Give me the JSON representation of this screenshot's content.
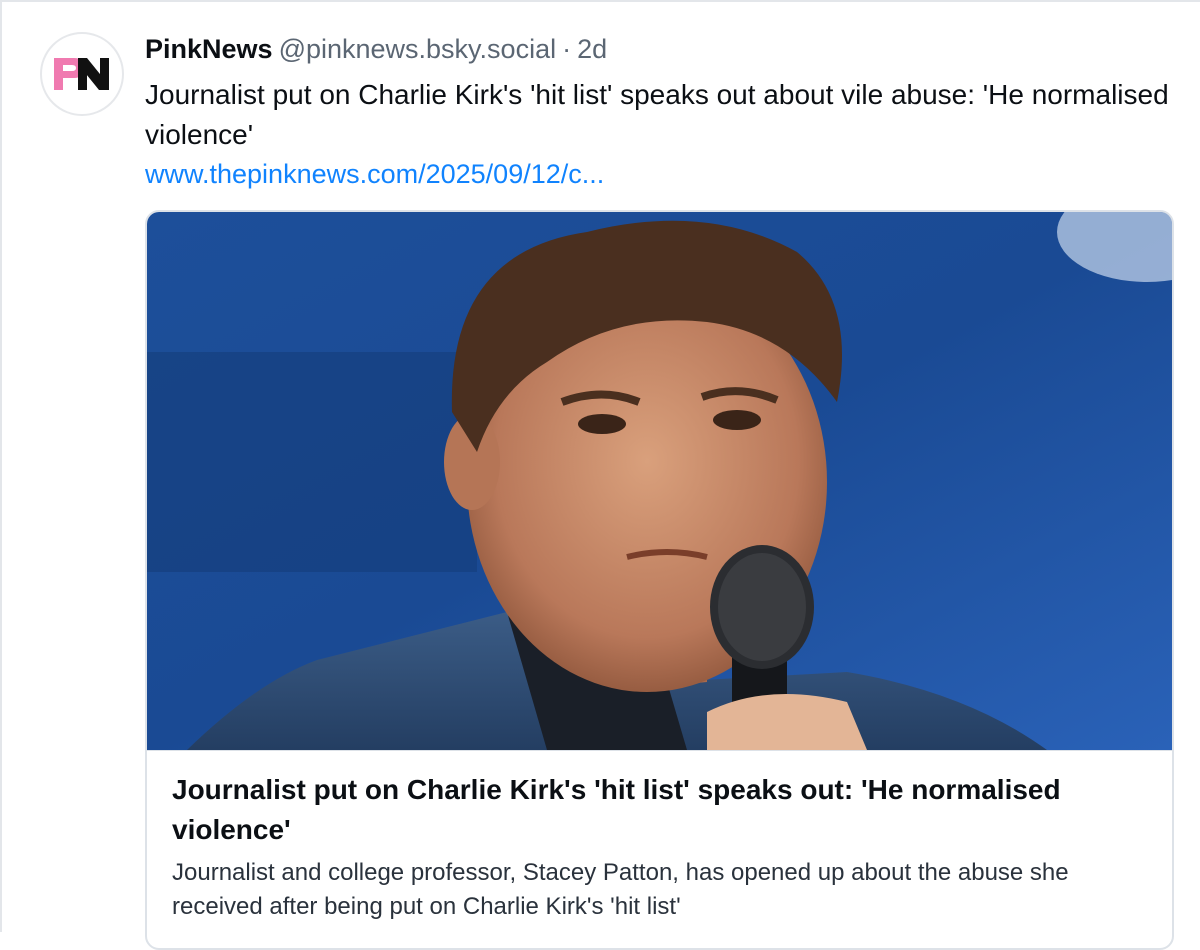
{
  "post": {
    "avatar_icon": "pinknews-logo",
    "avatar_letters": "PN",
    "display_name": "PinkNews",
    "handle": "@pinknews.bsky.social",
    "separator": "·",
    "time": "2d",
    "text": "Journalist put on Charlie Kirk's 'hit list' speaks out about vile abuse: 'He normalised violence'",
    "link": "www.thepinknews.com/2025/09/12/c..."
  },
  "card": {
    "image_icon": "man-speaking-into-microphone-photo",
    "title": "Journalist put on Charlie Kirk's 'hit list' speaks out: 'He normalised violence'",
    "description": "Journalist and college professor, Stacey Patton, has opened up about the abuse she received after being put on Charlie Kirk's 'hit list'"
  },
  "colors": {
    "link": "#1083fe",
    "text": "#0b0f14",
    "muted": "#5b6673",
    "brand_pink": "#f07ab0",
    "brand_black": "#111111"
  }
}
